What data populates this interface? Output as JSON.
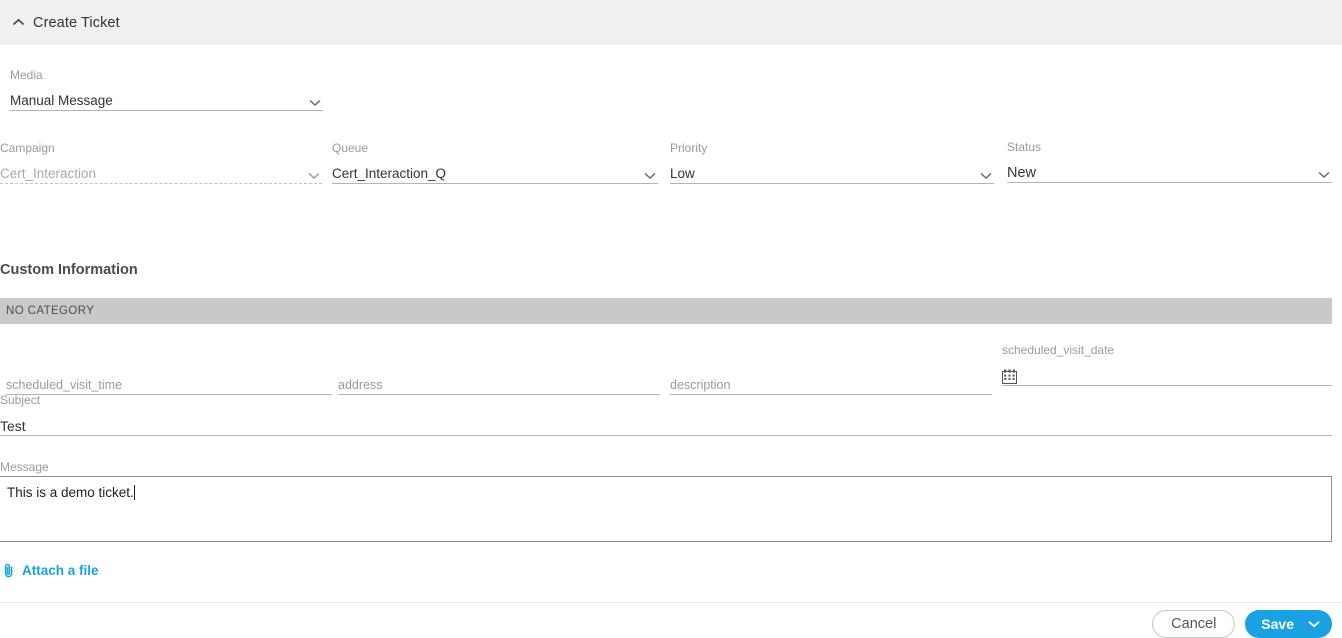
{
  "header": {
    "title": "Create Ticket",
    "collapse_icon": "chevron-up-icon"
  },
  "fields": {
    "media": {
      "label": "Media",
      "value": "Manual Message",
      "icon": "chevron-down-icon"
    },
    "campaign": {
      "label": "Campaign",
      "value": "Cert_Interaction",
      "icon": "chevron-down-icon",
      "state": "disabled"
    },
    "queue": {
      "label": "Queue",
      "value": "Cert_Interaction_Q",
      "icon": "chevron-down-icon"
    },
    "priority": {
      "label": "Priority",
      "value": "Low",
      "icon": "chevron-down-icon"
    },
    "status": {
      "label": "Status",
      "value": "New",
      "icon": "chevron-down-icon"
    }
  },
  "custom_information": {
    "title": "Custom Information",
    "category_band": "NO CATEGORY",
    "custom_fields": {
      "scheduled_visit_time": {
        "placeholder": "scheduled_visit_time",
        "value": ""
      },
      "address": {
        "placeholder": "address",
        "value": ""
      },
      "description": {
        "placeholder": "description",
        "value": ""
      },
      "scheduled_visit_date": {
        "label": "scheduled_visit_date",
        "value": "",
        "icon": "calendar-icon"
      }
    }
  },
  "subject": {
    "label": "Subject",
    "value": "Test"
  },
  "message": {
    "label": "Message",
    "value": "This is a demo ticket."
  },
  "attachment": {
    "label": "Attach a file",
    "icon": "paperclip-icon"
  },
  "footer": {
    "cancel_label": "Cancel",
    "save_label": "Save",
    "save_menu_icon": "chevron-down-icon"
  },
  "colors": {
    "accent": "#1ba1e2",
    "header_background": "#f1f1f1",
    "category_band": "#c9c9c9",
    "label_text": "#9a9a9a"
  }
}
